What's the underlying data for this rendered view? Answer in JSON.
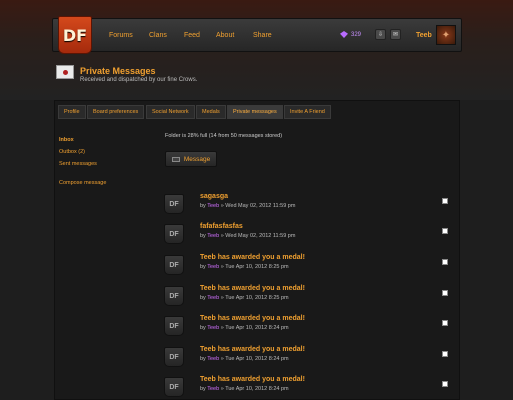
{
  "header": {
    "logo": "DF",
    "nav": [
      "Forums",
      "Clans",
      "Feed",
      "About",
      "Share"
    ],
    "gem_count": "329",
    "notify_icon": "person-icon",
    "mail_icon": "mail-icon",
    "username": "Teeb"
  },
  "page": {
    "title": "Private Messages",
    "subtitle": "Received and dispatched by our fine Crows."
  },
  "tabs": [
    "Profile",
    "Board preferences",
    "Social Network",
    "Medals",
    "Private messages",
    "Invite A Friend"
  ],
  "active_tab": "Private messages",
  "sidebar": {
    "inbox": "Inbox",
    "outbox": "Outbox (2)",
    "sent": "Sent messages",
    "compose": "Compose message"
  },
  "folder": {
    "info": "Folder is 28% full (14 from 50 messages stored)",
    "button_label": "Message"
  },
  "messages": [
    {
      "subject": "sagasga",
      "by": "by",
      "author": "Teeb",
      "date": "» Wed May 02, 2012 11:59 pm"
    },
    {
      "subject": "fafafasfasfas",
      "by": "by",
      "author": "Teeb",
      "date": "» Wed May 02, 2012 11:59 pm"
    },
    {
      "subject": "Teeb has awarded you a medal!",
      "by": "by",
      "author": "Teeb",
      "date": "» Tue Apr 10, 2012 8:25 pm"
    },
    {
      "subject": "Teeb has awarded you a medal!",
      "by": "by",
      "author": "Teeb",
      "date": "» Tue Apr 10, 2012 8:25 pm"
    },
    {
      "subject": "Teeb has awarded you a medal!",
      "by": "by",
      "author": "Teeb",
      "date": "» Tue Apr 10, 2012 8:24 pm"
    },
    {
      "subject": "Teeb has awarded you a medal!",
      "by": "by",
      "author": "Teeb",
      "date": "» Tue Apr 10, 2012 8:24 pm"
    },
    {
      "subject": "Teeb has awarded you a medal!",
      "by": "by",
      "author": "Teeb",
      "date": "» Tue Apr 10, 2012 8:24 pm"
    }
  ],
  "badge_text": "DF",
  "colors": {
    "accent": "#f0a030",
    "author": "#d070ff",
    "logo": "#c43d16"
  }
}
